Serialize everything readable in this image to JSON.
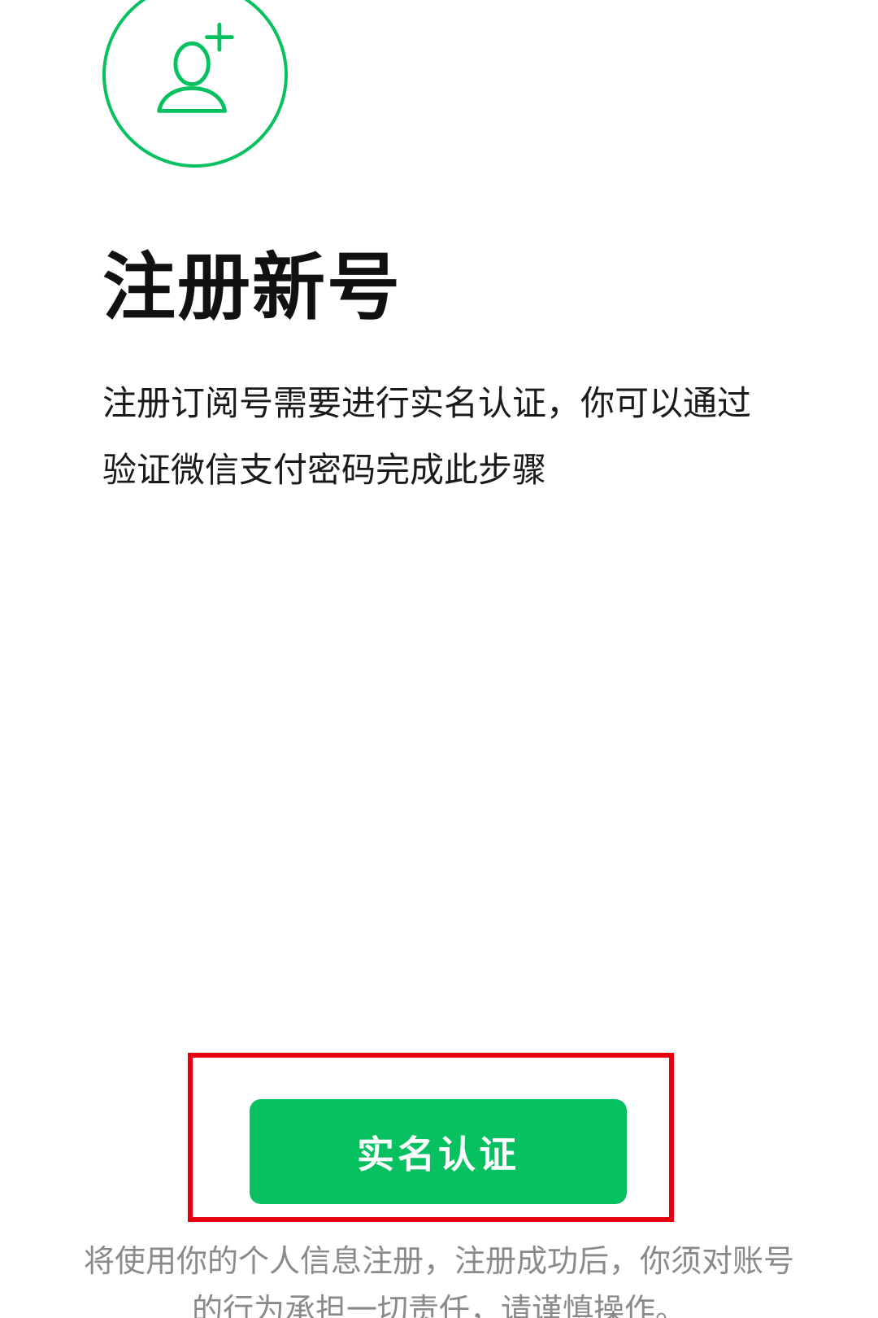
{
  "colors": {
    "accent": "#07C160",
    "highlight": "#E60012",
    "title_text": "#111111",
    "body_text": "#1a1a1a",
    "notice_text": "#8a8a8a"
  },
  "header": {
    "icon": "add-user-icon"
  },
  "main": {
    "title": "注册新号",
    "description": "注册订阅号需要进行实名认证，你可以通过验证微信支付密码完成此步骤"
  },
  "actions": {
    "verify_button_label": "实名认证"
  },
  "footer": {
    "notice": "将使用你的个人信息注册，注册成功后，你须对账号的行为承担一切责任，请谨慎操作。"
  }
}
